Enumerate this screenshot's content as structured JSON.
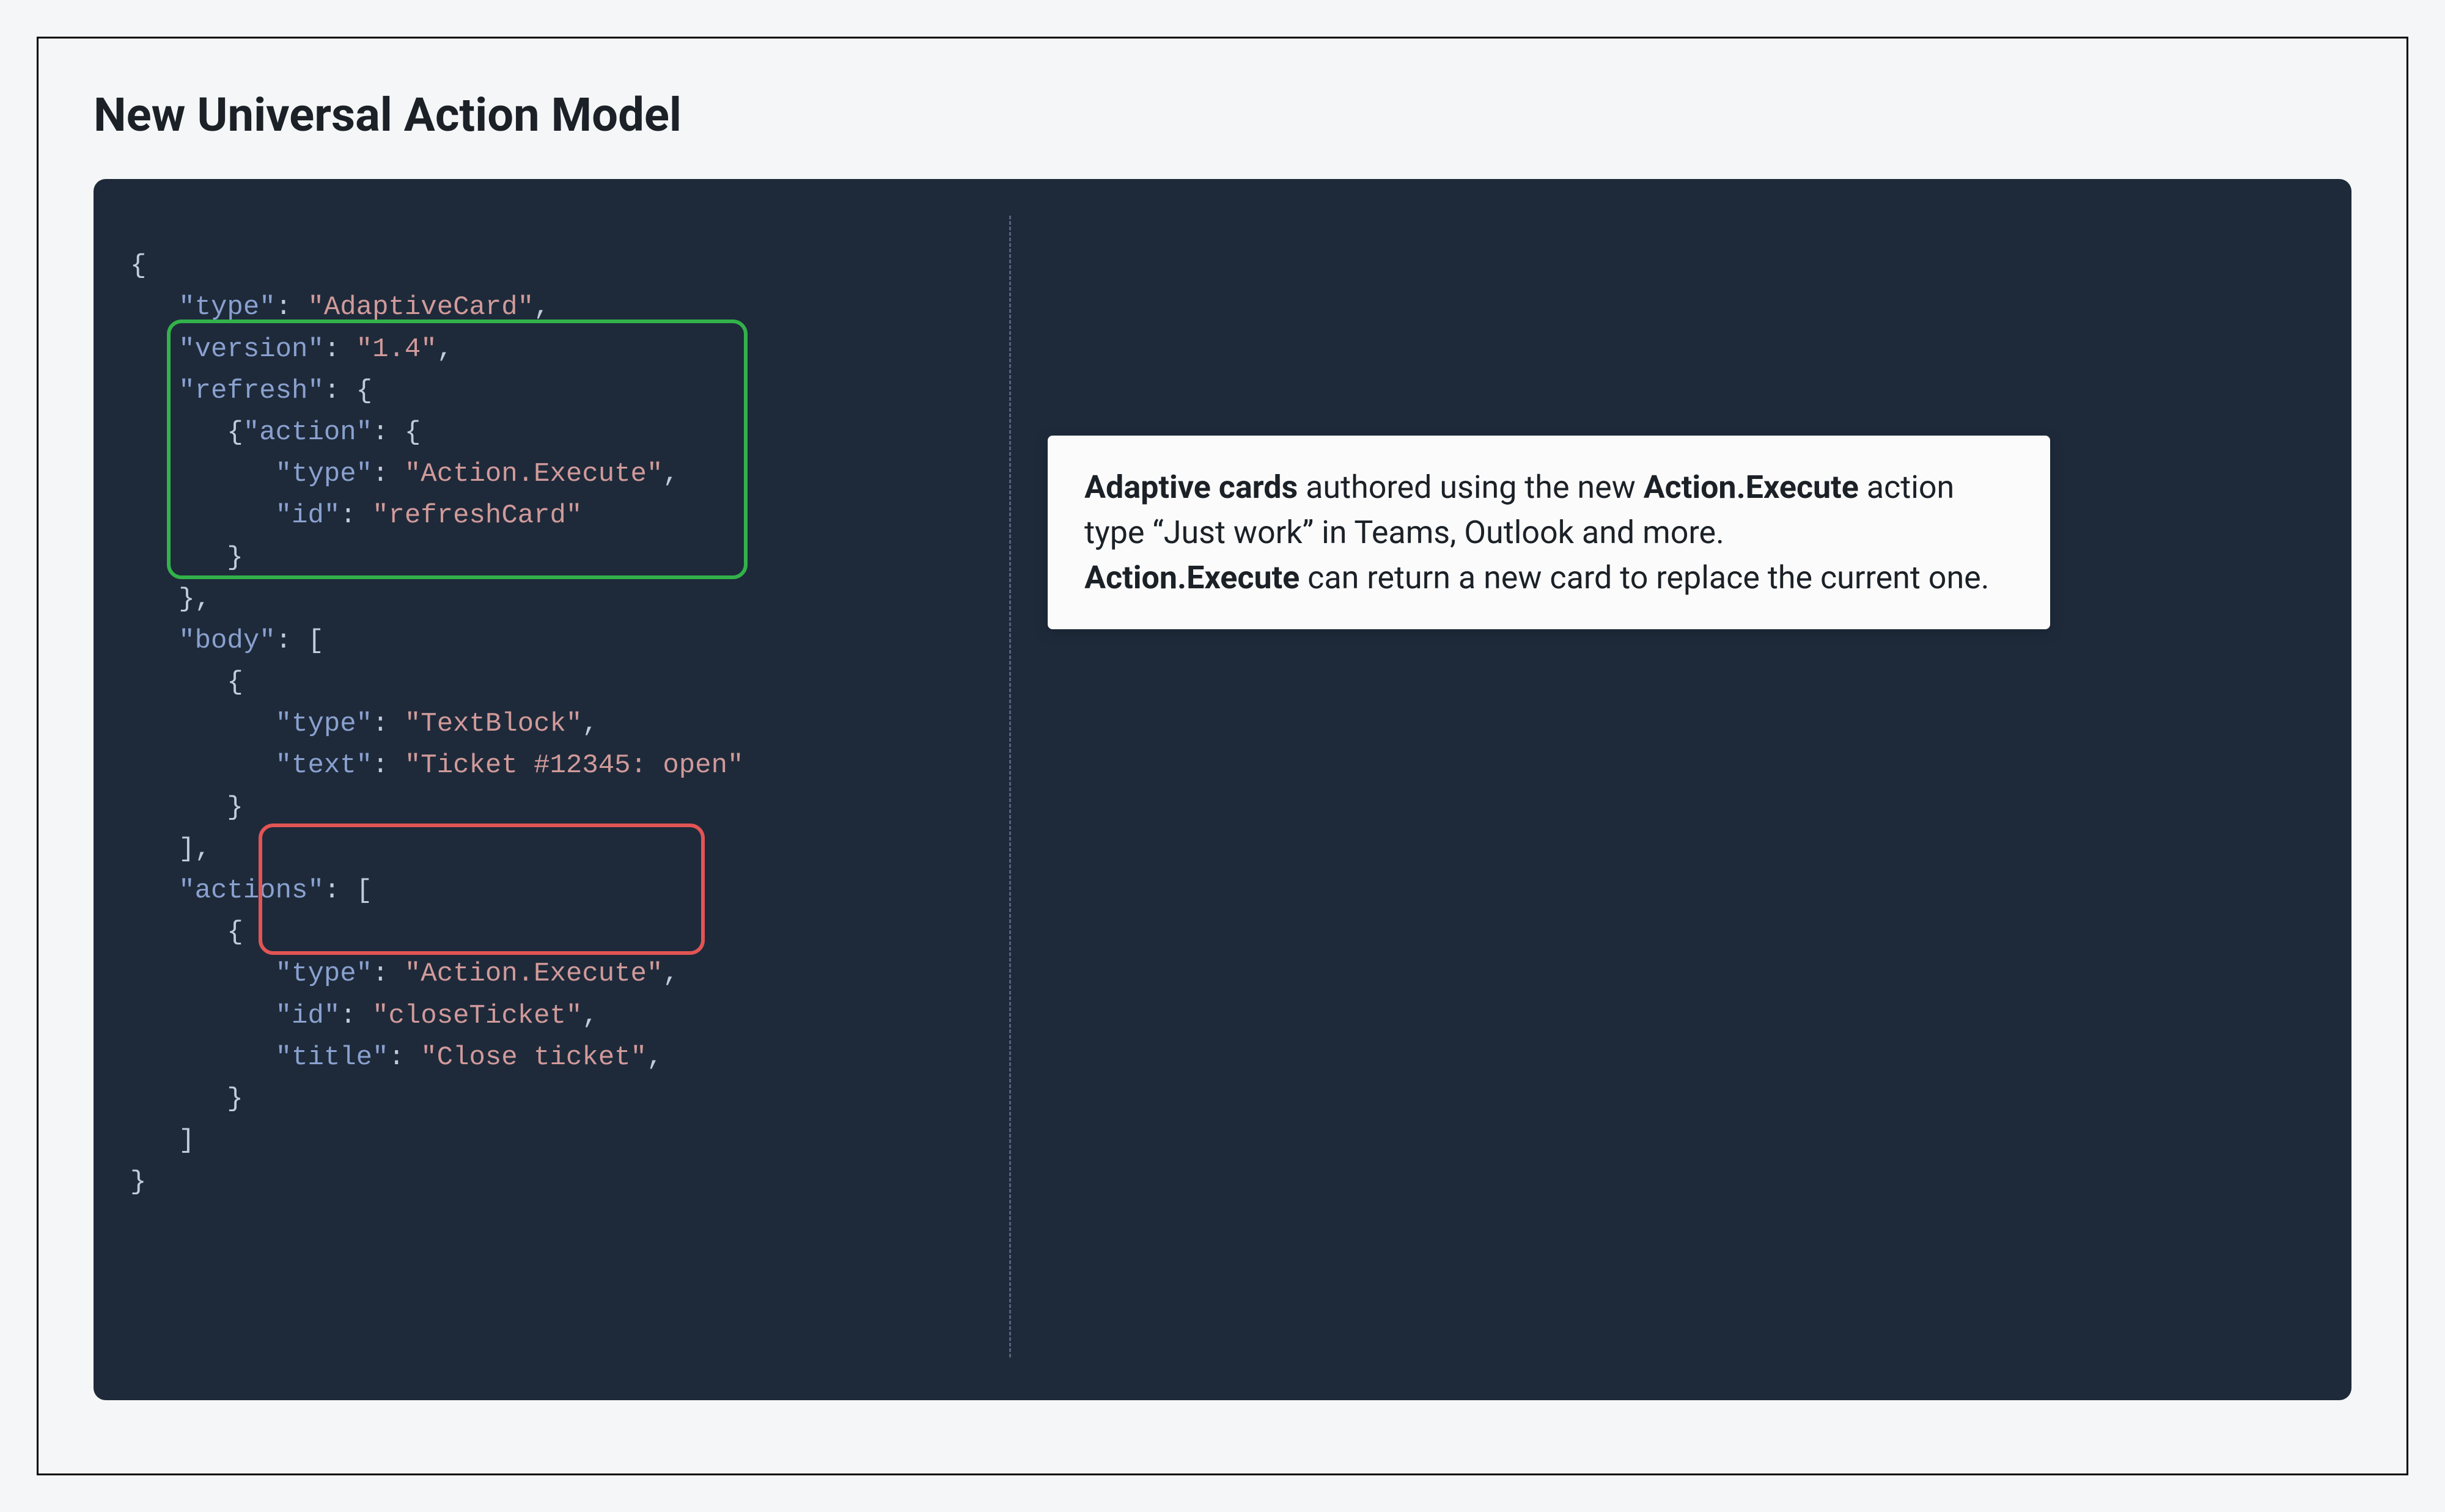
{
  "heading": "New Universal Action Model",
  "code": {
    "l1": "{",
    "l2a": "   \"type\"",
    "l2b": ": ",
    "l2c": "\"AdaptiveCard\"",
    "l2d": ",",
    "l3a": "   \"version\"",
    "l3b": ": ",
    "l3c": "\"1.4\"",
    "l3d": ",",
    "l4a": "   \"refresh\"",
    "l4b": ": {",
    "l5a": "      {",
    "l5b": "\"action\"",
    "l5c": ": {",
    "l6a": "         \"type\"",
    "l6b": ": ",
    "l6c": "\"Action.Execute\"",
    "l6d": ",",
    "l7a": "         \"id\"",
    "l7b": ": ",
    "l7c": "\"refreshCard\"",
    "l8": "      }",
    "l9": "   },",
    "l10a": "   \"body\"",
    "l10b": ": [",
    "l11": "      {",
    "l12a": "         \"type\"",
    "l12b": ": ",
    "l12c": "\"TextBlock\"",
    "l12d": ",",
    "l13a": "         \"text\"",
    "l13b": ": ",
    "l13c": "\"Ticket #12345: open\"",
    "l14": "      }",
    "l15": "   ],",
    "l16a": "   \"actions\"",
    "l16b": ": [",
    "l17": "      {",
    "l18a": "         \"type\"",
    "l18b": ": ",
    "l18c": "\"Action.Execute\"",
    "l18d": ",",
    "l19a": "         \"id\"",
    "l19b": ": ",
    "l19c": "\"closeTicket\"",
    "l19d": ",",
    "l20a": "         \"title\"",
    "l20b": ": ",
    "l20c": "\"Close ticket\"",
    "l20d": ",",
    "l21": "      }",
    "l22": "   ]",
    "l23": "}"
  },
  "desc": {
    "p1a": "Adaptive cards",
    "p1b": " authored using the new ",
    "p1c": "Action.Execute",
    "p1d": " action type “Just work” in Teams, Outlook and more.",
    "p2a": "Action.Execute",
    "p2b": " can return a new card to replace the current one."
  }
}
